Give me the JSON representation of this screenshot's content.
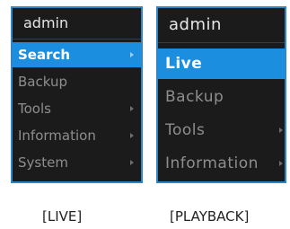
{
  "colors": {
    "menu_background": "#1b1b1b",
    "border": "#2f86c4",
    "selected_background": "#1c8ee0",
    "item_text": "#8e8e8e",
    "selected_text": "#ffffff"
  },
  "live_menu": {
    "header": "admin",
    "items": [
      {
        "label": "Search",
        "selected": true,
        "has_submenu": true
      },
      {
        "label": "Backup",
        "selected": false,
        "has_submenu": false
      },
      {
        "label": "Tools",
        "selected": false,
        "has_submenu": true
      },
      {
        "label": "Information",
        "selected": false,
        "has_submenu": true
      },
      {
        "label": "System",
        "selected": false,
        "has_submenu": true
      }
    ],
    "caption": "[LIVE]"
  },
  "playback_menu": {
    "header": "admin",
    "items": [
      {
        "label": "Live",
        "selected": true,
        "has_submenu": false
      },
      {
        "label": "Backup",
        "selected": false,
        "has_submenu": false
      },
      {
        "label": "Tools",
        "selected": false,
        "has_submenu": true
      },
      {
        "label": "Information",
        "selected": false,
        "has_submenu": true
      }
    ],
    "caption": "[PLAYBACK]"
  }
}
